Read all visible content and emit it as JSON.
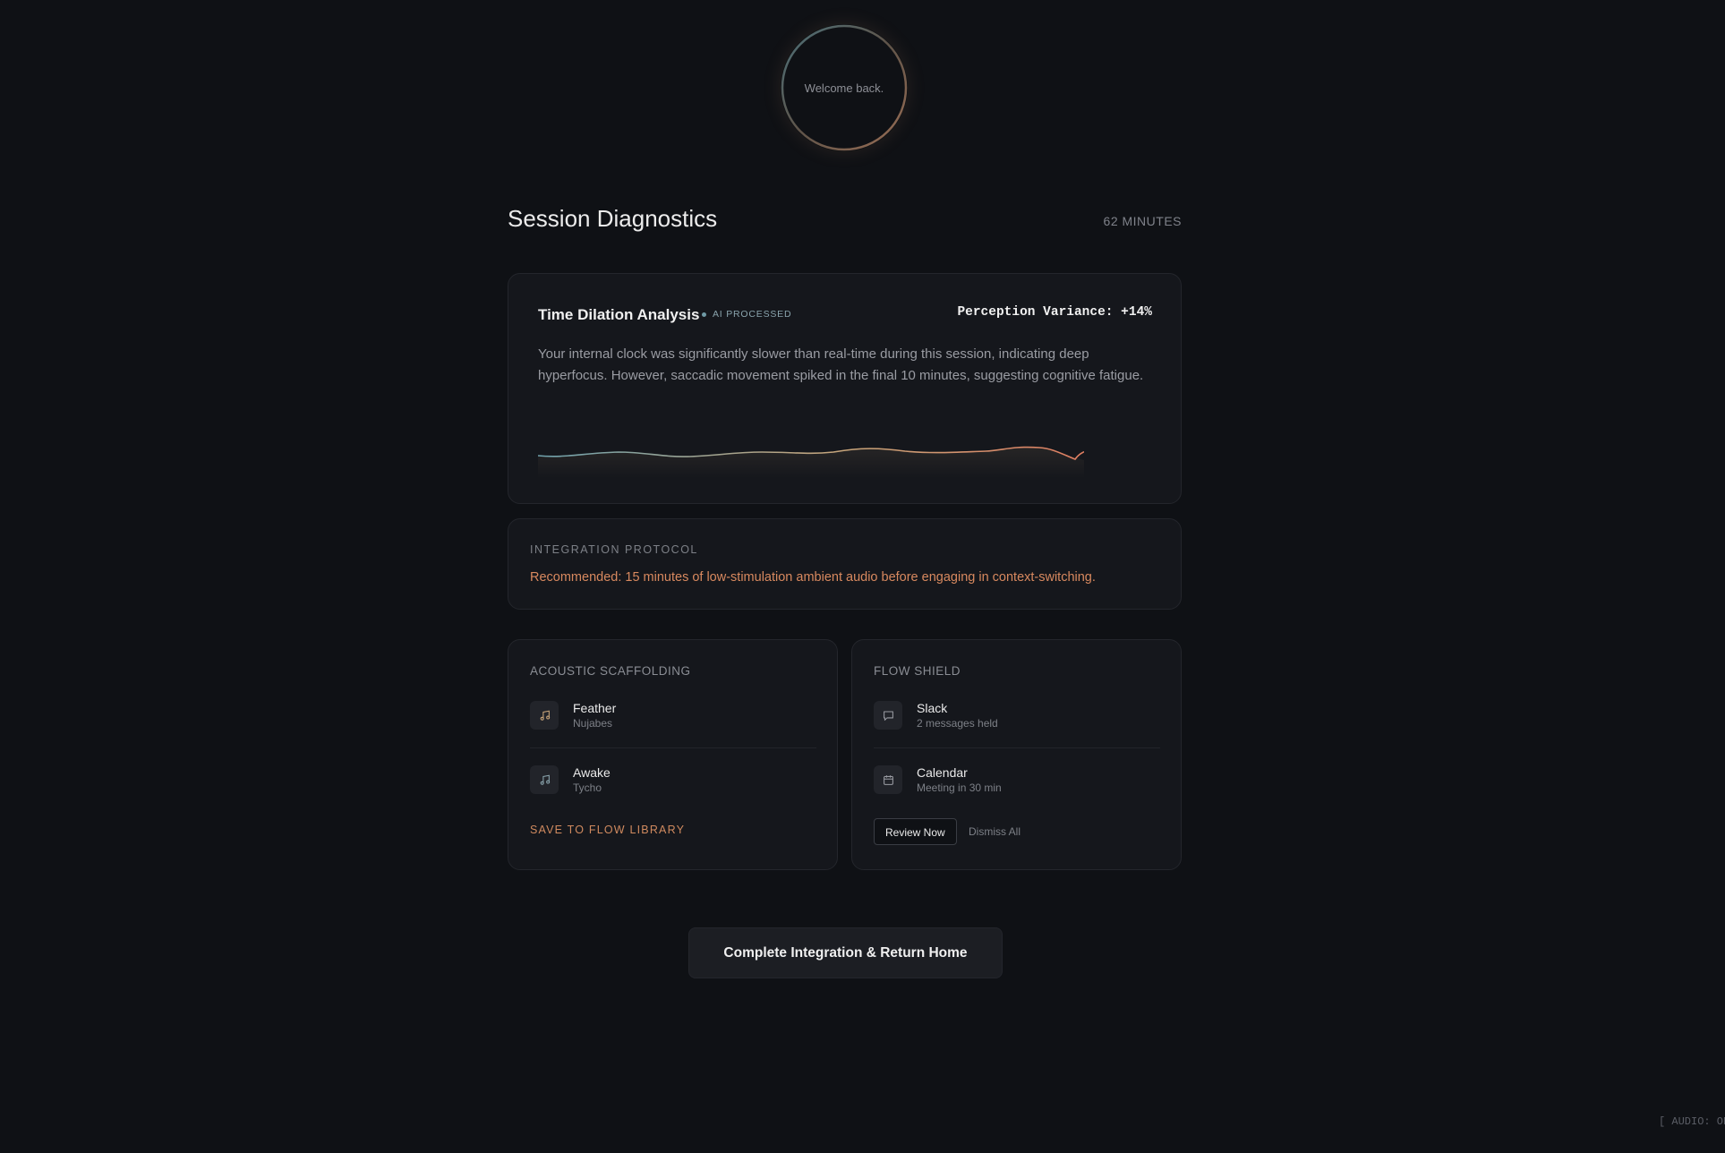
{
  "orb": {
    "text": "Welcome back."
  },
  "header": {
    "title": "Session Diagnostics",
    "minutes": "62 MINUTES"
  },
  "time_dilation": {
    "title": "Time Dilation Analysis",
    "badge": "AI PROCESSED",
    "variance": "Perception Variance: +14%",
    "body": "Your internal clock was significantly slower than real-time during this session, indicating deep hyperfocus. However, saccadic movement spiked in the final 10 minutes, suggesting cognitive fatigue.",
    "wave_colors": {
      "start": "#6fa2ad",
      "mid": "#c9a57a",
      "end": "#e07a5f"
    }
  },
  "protocol": {
    "label": "INTEGRATION PROTOCOL",
    "text": "Recommended: 15 minutes of low-stimulation ambient audio before engaging in context-switching."
  },
  "acoustic": {
    "label": "ACOUSTIC SCAFFOLDING",
    "tracks": [
      {
        "icon": "music-note-icon",
        "name": "Feather",
        "artist": "Nujabes"
      },
      {
        "icon": "music-note-icon",
        "name": "Awake",
        "artist": "Tycho"
      }
    ],
    "save_label": "SAVE TO FLOW LIBRARY"
  },
  "shield": {
    "label": "FLOW SHIELD",
    "items": [
      {
        "icon": "chat-bubble-icon",
        "name": "Slack",
        "detail": "2 messages held"
      },
      {
        "icon": "calendar-icon",
        "name": "Calendar",
        "detail": "Meeting in 30 min"
      }
    ],
    "review_label": "Review Now",
    "dismiss_label": "Dismiss All"
  },
  "cta": {
    "label": "Complete Integration & Return Home"
  },
  "status": {
    "audio": "[ AUDIO: ON ]"
  },
  "colors": {
    "accent": "#d8895f",
    "background": "#0f1115",
    "card": "#15171c"
  }
}
